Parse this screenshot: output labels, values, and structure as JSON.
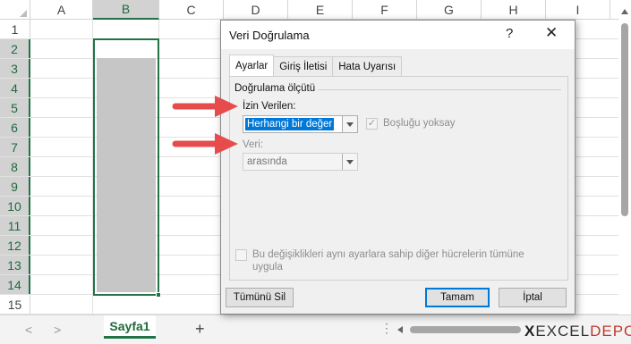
{
  "spreadsheet": {
    "columns": [
      "A",
      "B",
      "C",
      "D",
      "E",
      "F",
      "G",
      "H",
      "I"
    ],
    "selected_column": "B",
    "rows": [
      "1",
      "2",
      "3",
      "4",
      "5",
      "6",
      "7",
      "8",
      "9",
      "10",
      "11",
      "12",
      "13",
      "14",
      "15"
    ],
    "selected_rows": [
      "2",
      "3",
      "4",
      "5",
      "6",
      "7",
      "8",
      "9",
      "10",
      "11",
      "12",
      "13",
      "14"
    ]
  },
  "tabbar": {
    "sheet_tab": "Sayfa1",
    "add_sheet": "+",
    "prev_arrow": "<",
    "next_arrow": ">",
    "dots": "⋮",
    "brand_x": "X",
    "brand_excel": "EXCEL",
    "brand_depo": "DEPO"
  },
  "dialog": {
    "title": "Veri Doğrulama",
    "help": "?",
    "close": "✕",
    "tabs": [
      "Ayarlar",
      "Giriş İletisi",
      "Hata Uyarısı"
    ],
    "section": "Doğrulama ölçütü",
    "allow_label": "İzin Verilen:",
    "allow_value": "Herhangi bir değer",
    "ignore_blank_label": "Boşluğu yoksay",
    "data_label": "Veri:",
    "data_value": "arasında",
    "apply_all_label": "Bu değişiklikleri aynı ayarlara sahip diğer hücrelerin tümüne uygula",
    "clear_all": "Tümünü Sil",
    "ok": "Tamam",
    "cancel": "İptal"
  },
  "colors": {
    "excel_green": "#217346",
    "highlight_blue": "#0078d7",
    "arrow_red": "#e74c4c"
  }
}
